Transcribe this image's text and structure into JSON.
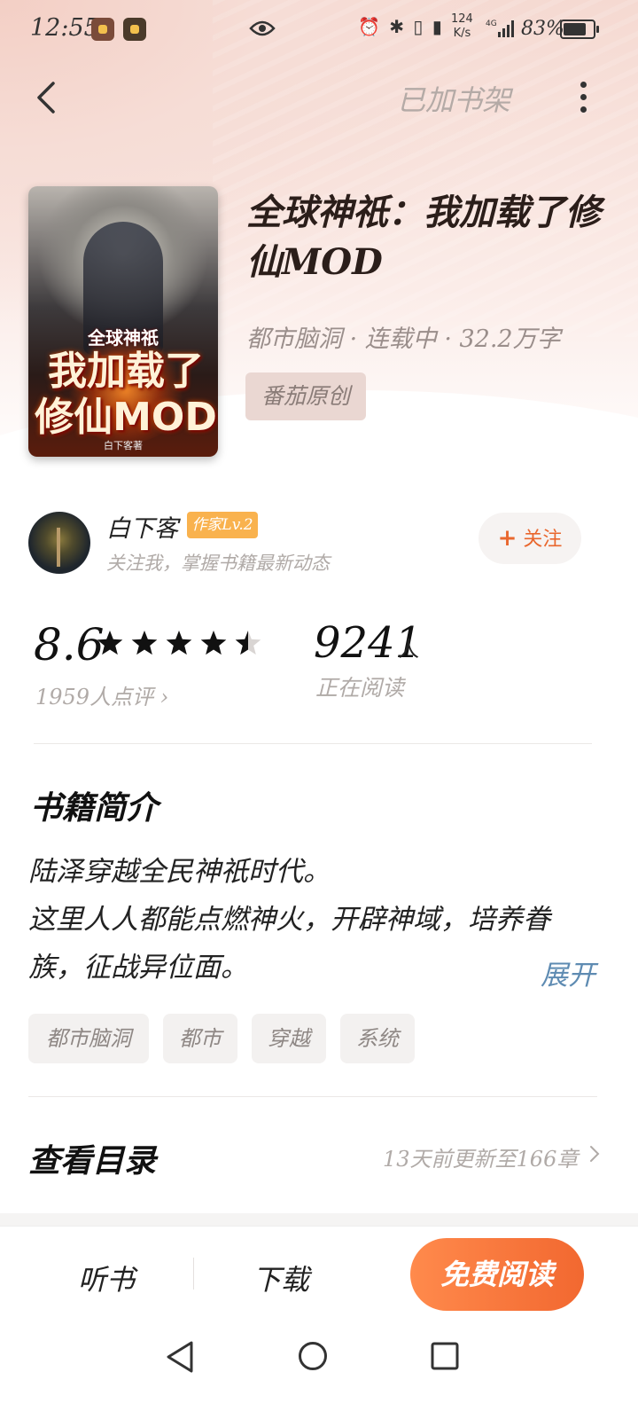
{
  "status_bar": {
    "time": "12:55",
    "net_speed_value": "124",
    "net_speed_unit": "K/s",
    "network": "4G",
    "battery_percent": "83%",
    "battery_level": 0.83
  },
  "header": {
    "shelf_status": "已加书架"
  },
  "book": {
    "cover": {
      "sub_title": "全球神祇",
      "main_title": "我加载了修仙MOD",
      "author": "白下客著"
    },
    "title": "全球神祇：我加载了修仙MOD",
    "meta": "都市脑洞 · 连载中 · 32.2万字",
    "source_badge": "番茄原创"
  },
  "author": {
    "name": "白下客",
    "level_badge": "作家Lv.2",
    "description": "关注我，掌握书籍最新动态",
    "follow_label": "关注",
    "follow_plus": "+"
  },
  "rating": {
    "score": "8.6",
    "score_value": 8.6,
    "stars": 4.5,
    "review_count": "1959人点评",
    "readers_value": "9241",
    "readers_unit": "人",
    "readers_label": "正在阅读"
  },
  "intro": {
    "section_title": "书籍简介",
    "text_line1": "陆泽穿越全民神祇时代。",
    "text_line2": "这里人人都能点燃神火，开辟神域，培养眷族，征战异位面。",
    "expand_label": "展开"
  },
  "tags": [
    "都市脑洞",
    "都市",
    "穿越",
    "系统"
  ],
  "toc": {
    "title": "查看目录",
    "update_info": "13天前更新至166章"
  },
  "bottom_bar": {
    "listen_label": "听书",
    "download_label": "下载",
    "read_label": "免费阅读"
  },
  "colors": {
    "accent": "#f26830",
    "star": "#111111",
    "badge": "#f9b24e",
    "expand": "#5e8bb2"
  }
}
